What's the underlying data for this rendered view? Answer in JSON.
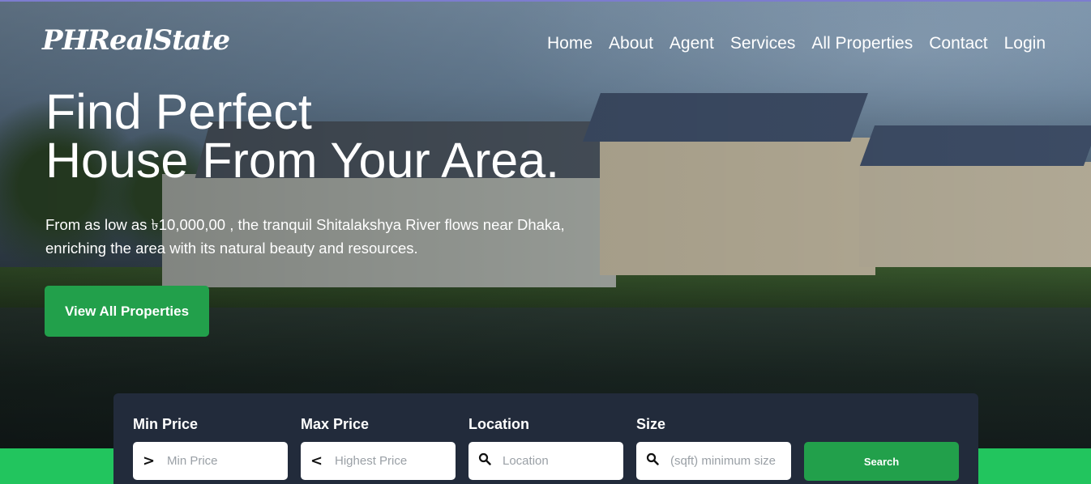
{
  "brand": {
    "logo": "PHRealState"
  },
  "nav": [
    "Home",
    "About",
    "Agent",
    "Services",
    "All Properties",
    "Contact",
    "Login"
  ],
  "hero": {
    "headline_line1": "Find Perfect",
    "headline_line2": "House From Your Area.",
    "subtitle_line1": "From as low as ৳10,000,00 , the tranquil Shitalakshya River flows near Dhaka,",
    "subtitle_line2": "enriching the area with its natural beauty and resources.",
    "cta_label": "View All Properties"
  },
  "search": {
    "fields": [
      {
        "label": "Min Price",
        "placeholder": "Min Price",
        "icon": "greater-than-icon"
      },
      {
        "label": "Max Price",
        "placeholder": "Highest Price",
        "icon": "less-than-icon"
      },
      {
        "label": "Location",
        "placeholder": "Location",
        "icon": "search-icon"
      },
      {
        "label": "Size",
        "placeholder": "(sqft) minimum size",
        "icon": "search-icon"
      }
    ],
    "button_label": "Search"
  },
  "colors": {
    "accent_green": "#22a04b",
    "band_green": "#22c55e",
    "panel": "#222b3b"
  }
}
